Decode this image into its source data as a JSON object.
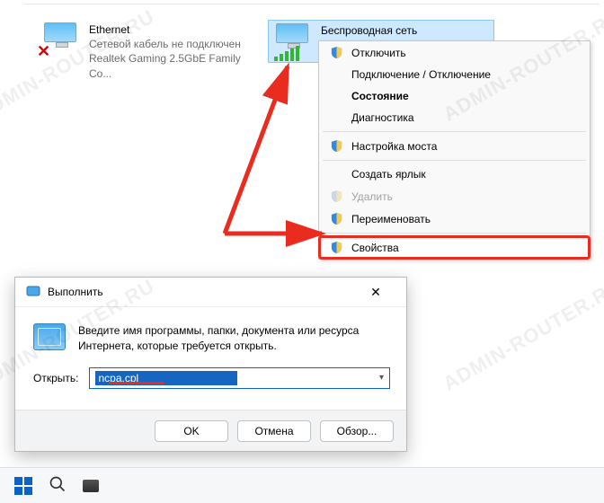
{
  "adapters": {
    "ethernet": {
      "name": "Ethernet",
      "status": "Сетевой кабель не подключен",
      "device": "Realtek Gaming 2.5GbE Family Co..."
    },
    "wireless": {
      "name": "Беспроводная сеть"
    }
  },
  "context_menu": {
    "disable": "Отключить",
    "connect": "Подключение / Отключение",
    "status": "Состояние",
    "diagnostics": "Диагностика",
    "bridge": "Настройка моста",
    "shortcut": "Создать ярлык",
    "delete": "Удалить",
    "rename": "Переименовать",
    "properties": "Свойства"
  },
  "run_dialog": {
    "title": "Выполнить",
    "description": "Введите имя программы, папки, документа или ресурса Интернета, которые требуется открыть.",
    "label": "Открыть:",
    "input_value": "ncpa.cpl",
    "close": "✕",
    "ok": "OK",
    "cancel": "Отмена",
    "browse": "Обзор..."
  },
  "watermark": "ADMIN-ROUTER.RU",
  "colors": {
    "selection": "#cde8ff",
    "highlight_border": "#ea2b1f",
    "accent": "#0a63c7"
  }
}
